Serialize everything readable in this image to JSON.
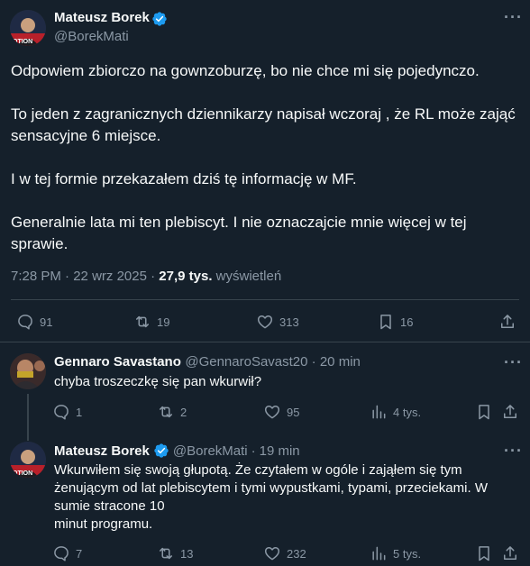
{
  "main_tweet": {
    "author_name": "Mateusz Borek",
    "handle": "@BorekMati",
    "paragraphs": [
      "Odpowiem zbiorczo na gownzoburzę, bo nie chce mi się pojedynczo.",
      "To jeden z zagranicznych dziennikarzy napisał wczoraj , że RL może zająć sensacyjne 6 miejsce.",
      "I w tej formie przekazałem dziś tę informację w MF.",
      "Generalnie lata mi ten plebiscyt. I nie oznaczajcie mnie więcej w tej sprawie."
    ],
    "time": "7:28 PM",
    "date": "22 wrz 2025",
    "views_count": "27,9 tys.",
    "views_label": "wyświetleń",
    "replies": "91",
    "retweets": "19",
    "likes": "313",
    "bookmarks": "16"
  },
  "reply1": {
    "author_name": "Gennaro Savastano",
    "handle": "@GennaroSavast20",
    "time": "20 min",
    "text": "chyba troszeczkę się pan wkurwił?",
    "replies": "1",
    "retweets": "2",
    "likes": "95",
    "views": "4 tys."
  },
  "reply2": {
    "author_name": "Mateusz Borek",
    "handle": "@BorekMati",
    "time": "19 min",
    "lines": [
      "Wkurwiłem się swoją głupotą. Że czytałem w ogóle i zająłem się tym",
      "żenującym od lat plebiscytem i tymi wypustkami, typami, przeciekami. W",
      "sumie stracone 10",
      "minut programu."
    ],
    "replies": "7",
    "retweets": "13",
    "likes": "232",
    "views": "5 tys."
  },
  "colors": {
    "background": "#15202b",
    "text": "#f7f9f9",
    "muted": "#8b98a5",
    "verified": "#1d9bf0",
    "divider": "#38444d"
  },
  "icons": [
    "more-icon",
    "verified-badge-icon",
    "reply-icon",
    "retweet-icon",
    "like-icon",
    "bookmark-icon",
    "share-icon",
    "views-icon"
  ]
}
